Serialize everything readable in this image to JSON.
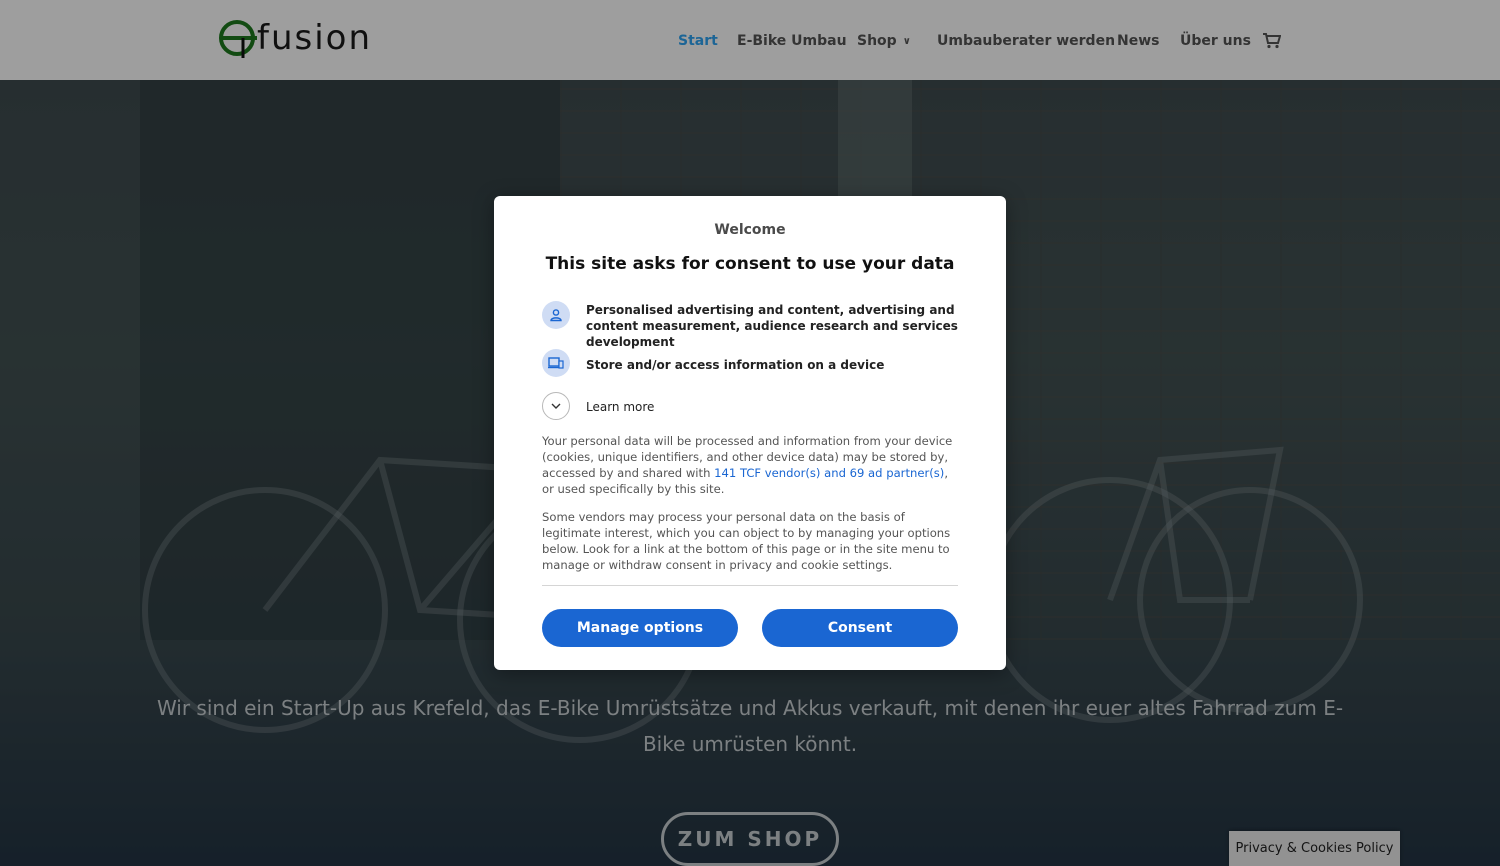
{
  "header": {
    "logo_text": "fusion",
    "nav": [
      {
        "label": "Start",
        "active": true
      },
      {
        "label": "E-Bike Umbau",
        "active": false
      },
      {
        "label": "Shop",
        "active": false,
        "dropdown": true
      },
      {
        "label": "Umbauberater werden",
        "active": false
      },
      {
        "label": "News",
        "active": false
      },
      {
        "label": "Über uns",
        "active": false
      }
    ],
    "cart_icon": "cart-icon"
  },
  "hero": {
    "text": "Wir sind ein Start-Up aus Krefeld, das E-Bike Umrüstsätze und Akkus verkauft, mit denen ihr euer altes Fahrrad zum E-Bike umrüsten könnt.",
    "button_label": "ZUM SHOP"
  },
  "consent": {
    "welcome": "Welcome",
    "title": "This site asks for consent to use your data",
    "purposes": [
      {
        "icon": "person-icon",
        "text": "Personalised advertising and content, advertising and content measurement, audience research and services development"
      },
      {
        "icon": "devices-icon",
        "text": "Store and/or access information on a device"
      }
    ],
    "learn_more": "Learn more",
    "para1_before": "Your personal data will be processed and information from your device (cookies, unique identifiers, and other device data) may be stored by, accessed by and shared with ",
    "para1_link": "141 TCF vendor(s) and 69 ad partner(s)",
    "para1_after": ", or used specifically by this site.",
    "para2": "Some vendors may process your personal data on the basis of legitimate interest, which you can object to by managing your options below. Look for a link at the bottom of this page or in the site menu to manage or withdraw consent in privacy and cookie settings.",
    "manage_label": "Manage options",
    "consent_label": "Consent"
  },
  "privacy_tab": "Privacy & Cookies Policy",
  "colors": {
    "accent": "#1a66d2",
    "nav_active": "#2ea3f2",
    "logo_green": "#2aa02a"
  }
}
